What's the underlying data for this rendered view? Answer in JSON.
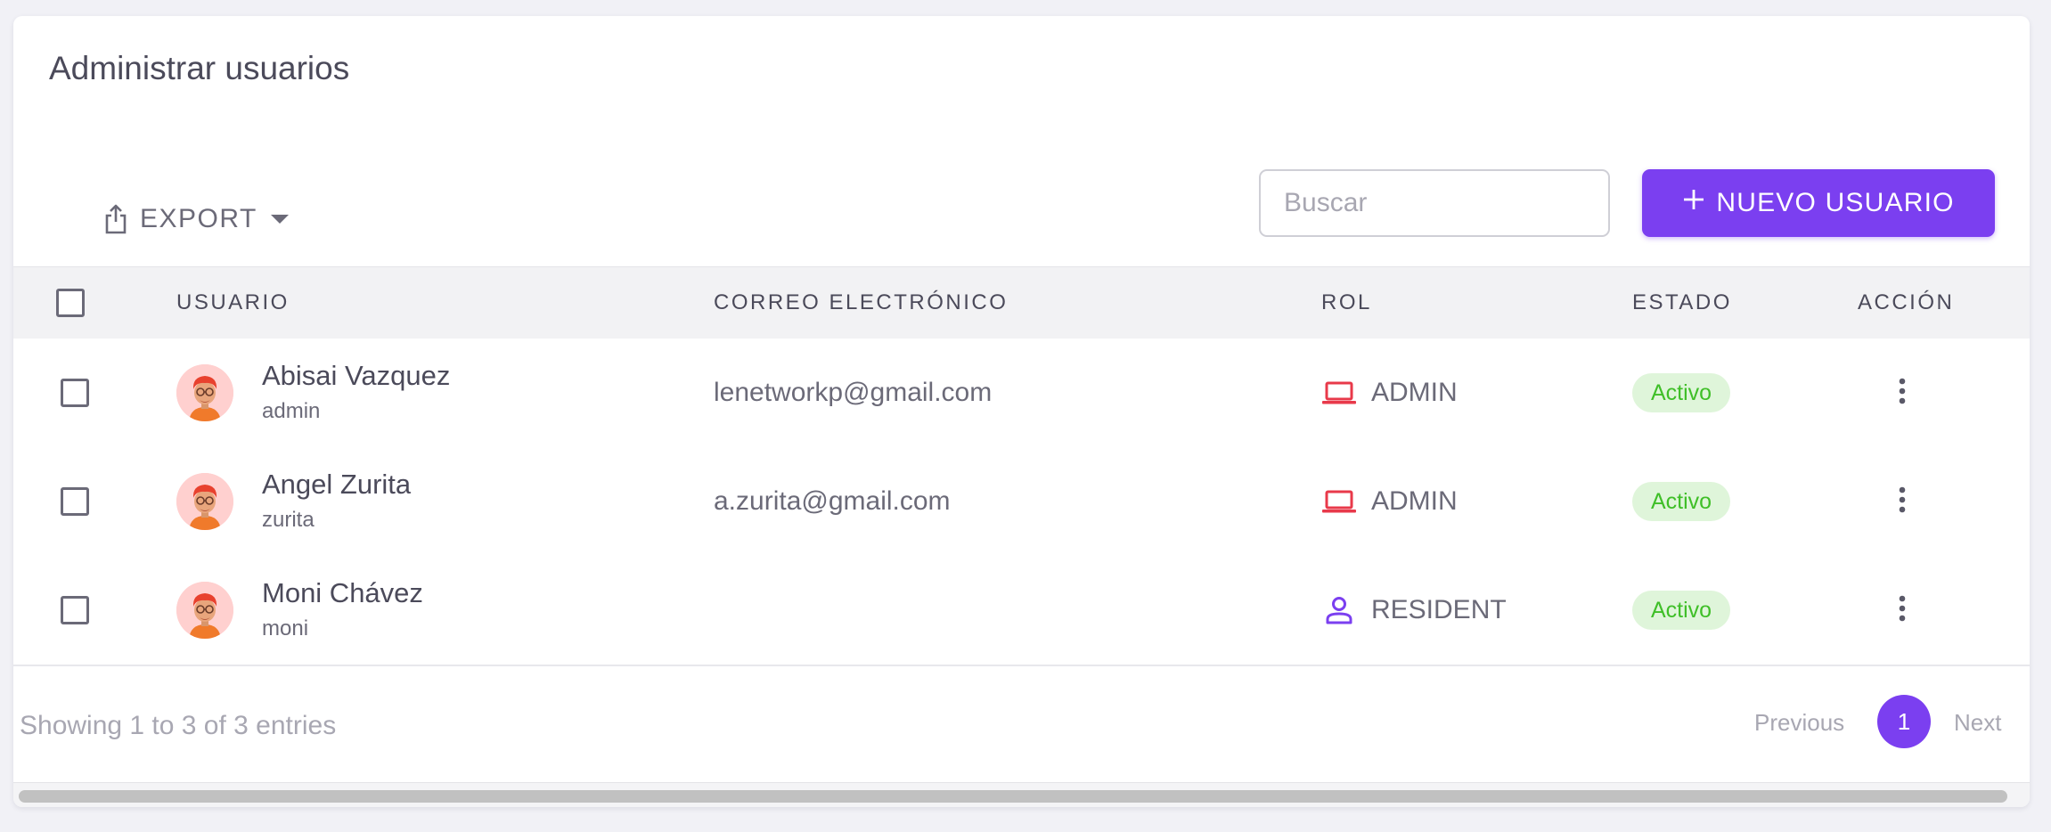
{
  "page": {
    "title": "Administrar usuarios"
  },
  "toolbar": {
    "export_label": "EXPORT",
    "search_placeholder": "Buscar",
    "search_value": "",
    "new_user_label": "NUEVO USUARIO"
  },
  "table": {
    "columns": {
      "user": "USUARIO",
      "email": "CORREO ELECTRÓNICO",
      "role": "ROL",
      "status": "ESTADO",
      "action": "ACCIÓN"
    },
    "rows": [
      {
        "name": "Abisai Vazquez",
        "username": "admin",
        "email": "lenetworkp@gmail.com",
        "role": "ADMIN",
        "role_icon": "laptop-icon",
        "status": "Activo"
      },
      {
        "name": "Angel Zurita",
        "username": "zurita",
        "email": "a.zurita@gmail.com",
        "role": "ADMIN",
        "role_icon": "laptop-icon",
        "status": "Activo"
      },
      {
        "name": "Moni Chávez",
        "username": "moni",
        "email": "",
        "role": "RESIDENT",
        "role_icon": "person-icon",
        "status": "Activo"
      }
    ]
  },
  "footer": {
    "entries_info": "Showing 1 to 3 of 3 entries",
    "prev_label": "Previous",
    "current_page": "1",
    "next_label": "Next"
  },
  "colors": {
    "accent": "#7b3ff0",
    "admin_icon": "#e8394a",
    "resident_icon": "#7b3ff0",
    "status_active_text": "#3fbf28",
    "status_active_bg": "#dff5da"
  }
}
